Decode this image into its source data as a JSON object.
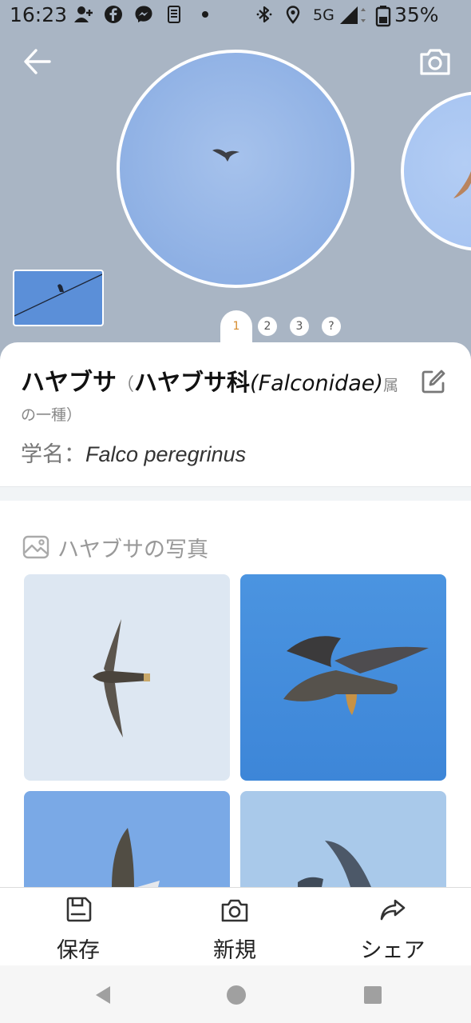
{
  "status_bar": {
    "time": "16:23",
    "network": "5G",
    "battery": "35%",
    "icons": [
      "person-add-icon",
      "facebook-icon",
      "messenger-icon",
      "sim-icon",
      "dot-icon",
      "bluetooth-icon",
      "location-icon",
      "signal-icon",
      "battery-icon"
    ]
  },
  "header": {
    "back_icon": "arrow-left-icon",
    "camera_icon": "camera-icon"
  },
  "pager": {
    "active": "1",
    "pages": [
      "2",
      "3",
      "?"
    ]
  },
  "species": {
    "name": "ハヤブサ",
    "open_paren": "（",
    "family": "ハヤブサ科",
    "family_latin": "(Falconidae)",
    "suffix_1": "属",
    "suffix_2": "の一種）",
    "sci_label": "学名：",
    "sci_name": "Falco peregrinus"
  },
  "photos": {
    "title": "ハヤブサの写真"
  },
  "actions": {
    "save": "保存",
    "new": "新規",
    "share": "シェア"
  },
  "colors": {
    "hero_bg": "#a9b5c4",
    "sky": "#8eb0e4",
    "active_page": "#d58a2c"
  }
}
